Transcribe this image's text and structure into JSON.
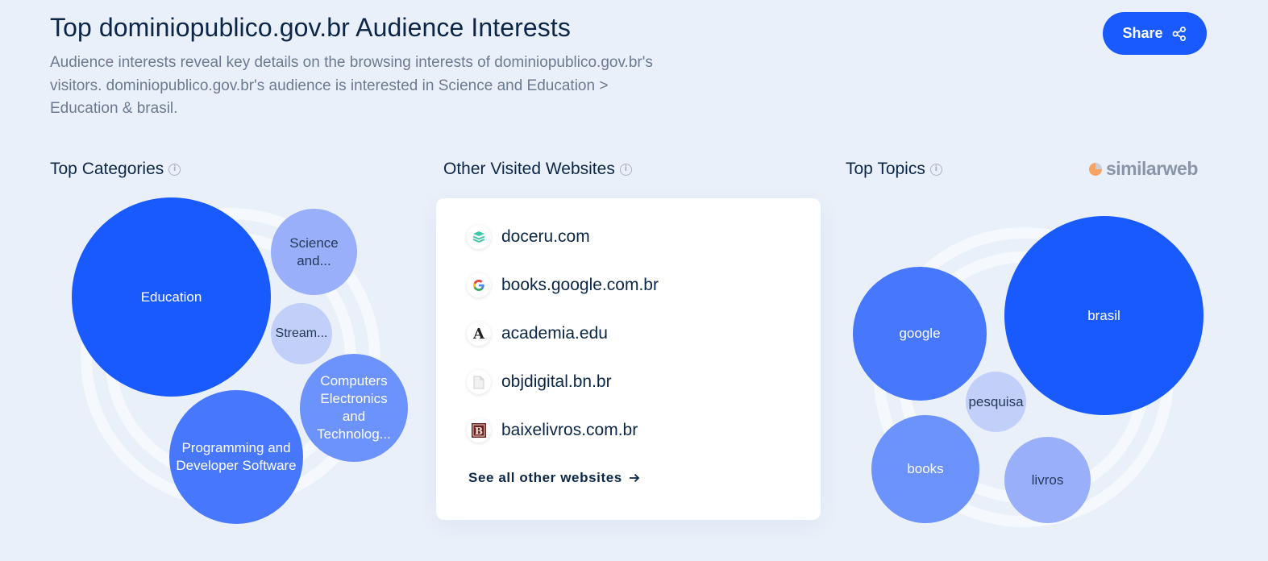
{
  "header": {
    "title": "Top dominiopublico.gov.br Audience Interests",
    "description": "Audience interests reveal key details on the browsing interests of dominiopublico.gov.br's visitors. dominiopublico.gov.br's audience is interested in Science and Education > Education & brasil.",
    "share_label": "Share",
    "share_icon": "share-icon"
  },
  "categories": {
    "title": "Top Categories",
    "info_icon": "info-icon",
    "bubbles": [
      {
        "label": "Education",
        "color": "#195afe"
      },
      {
        "label": "Science and...",
        "color": "#99aff9"
      },
      {
        "label": "Stream...",
        "color": "#c2cff8"
      },
      {
        "label": "Computers Electronics and Technolog...",
        "color": "#6c92fb"
      },
      {
        "label": "Programming and Developer Software",
        "color": "#4677fc"
      }
    ]
  },
  "websites": {
    "title": "Other Visited Websites",
    "info_icon": "info-icon",
    "items": [
      {
        "domain": "doceru.com",
        "icon": "doceru-favicon"
      },
      {
        "domain": "books.google.com.br",
        "icon": "google-favicon"
      },
      {
        "domain": "academia.edu",
        "icon": "academia-favicon"
      },
      {
        "domain": "objdigital.bn.br",
        "icon": "blank-page-favicon"
      },
      {
        "domain": "baixelivros.com.br",
        "icon": "baixelivros-favicon"
      }
    ],
    "see_all_label": "See all other websites",
    "see_all_icon": "arrow-right-icon"
  },
  "topics": {
    "title": "Top Topics",
    "info_icon": "info-icon",
    "brand": "similarweb",
    "bubbles": [
      {
        "label": "brasil",
        "color": "#195afe"
      },
      {
        "label": "google",
        "color": "#4677fc"
      },
      {
        "label": "pesquisa",
        "color": "#c2cff8"
      },
      {
        "label": "books",
        "color": "#6c92fb"
      },
      {
        "label": "livros",
        "color": "#99aff9"
      }
    ]
  },
  "colors": {
    "accent": "#195afe",
    "background": "#eaf0fa",
    "text_dark": "#0b2647",
    "text_muted": "#6b7a90"
  }
}
